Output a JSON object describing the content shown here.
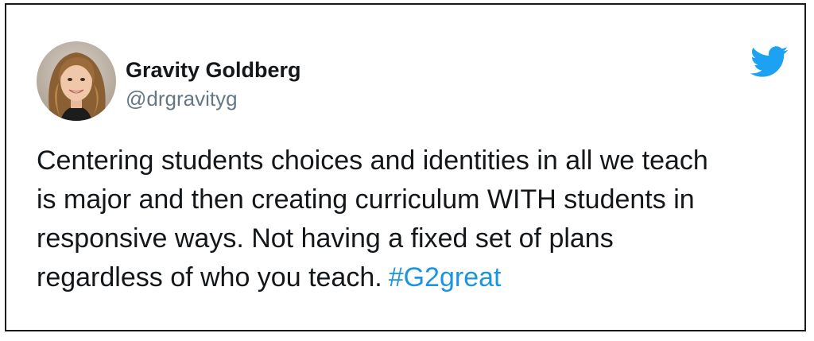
{
  "tweet": {
    "author_name": "Gravity Goldberg",
    "author_handle": "@drgravityg",
    "avatar_icon": "avatar-photo",
    "platform_icon": "twitter-bird-icon",
    "text_lines": [
      "Centering students choices and identities in all we teach",
      "is major and then creating curriculum WITH students in",
      "responsive ways. Not having a fixed set of plans",
      "regardless of who you teach."
    ],
    "hashtag": "#G2great"
  },
  "colors": {
    "text": "#14171a",
    "handle": "#657786",
    "link": "#1b95e0",
    "twitter_blue": "#1da1f2",
    "border": "#1a1a1a"
  }
}
